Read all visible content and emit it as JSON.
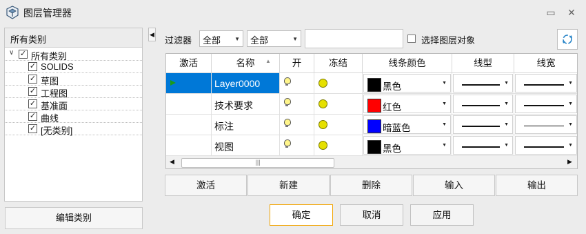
{
  "window": {
    "title": "图层管理器",
    "minimize_glyph": "▭",
    "close_glyph": "✕"
  },
  "left_panel": {
    "header": "所有类别",
    "tree": [
      {
        "label": "所有类别",
        "checked": true,
        "root": true
      },
      {
        "label": "SOLIDS",
        "checked": true
      },
      {
        "label": "草图",
        "checked": true
      },
      {
        "label": "工程图",
        "checked": true
      },
      {
        "label": "基准面",
        "checked": true
      },
      {
        "label": "曲线",
        "checked": true
      },
      {
        "label": "[无类别]",
        "checked": true
      }
    ],
    "edit_button": "编辑类别"
  },
  "filter": {
    "label": "过滤器",
    "select1": "全部",
    "select2": "全部",
    "text_value": "",
    "select_layer_objects": "选择图层对象"
  },
  "table": {
    "columns": [
      "激活",
      "名称",
      "开",
      "冻结",
      "线条颜色",
      "线型",
      "线宽"
    ],
    "rows": [
      {
        "active": true,
        "name": "Layer0000",
        "on": true,
        "frozen": false,
        "color_name": "黑色",
        "color": "#000000",
        "selected": true
      },
      {
        "active": false,
        "name": "技术要求",
        "on": true,
        "frozen": false,
        "color_name": "红色",
        "color": "#ff0000",
        "selected": false
      },
      {
        "active": false,
        "name": "标注",
        "on": true,
        "frozen": false,
        "color_name": "暗蓝色",
        "color": "#0000ff",
        "selected": false
      },
      {
        "active": false,
        "name": "视图",
        "on": true,
        "frozen": false,
        "color_name": "黑色",
        "color": "#000000",
        "selected": false
      }
    ]
  },
  "actions": [
    "激活",
    "新建",
    "删除",
    "输入",
    "输出"
  ],
  "dialog_buttons": {
    "ok": "确定",
    "cancel": "取消",
    "apply": "应用"
  },
  "colors": {
    "selection": "#0078d7",
    "accent_border": "#f2a400"
  }
}
